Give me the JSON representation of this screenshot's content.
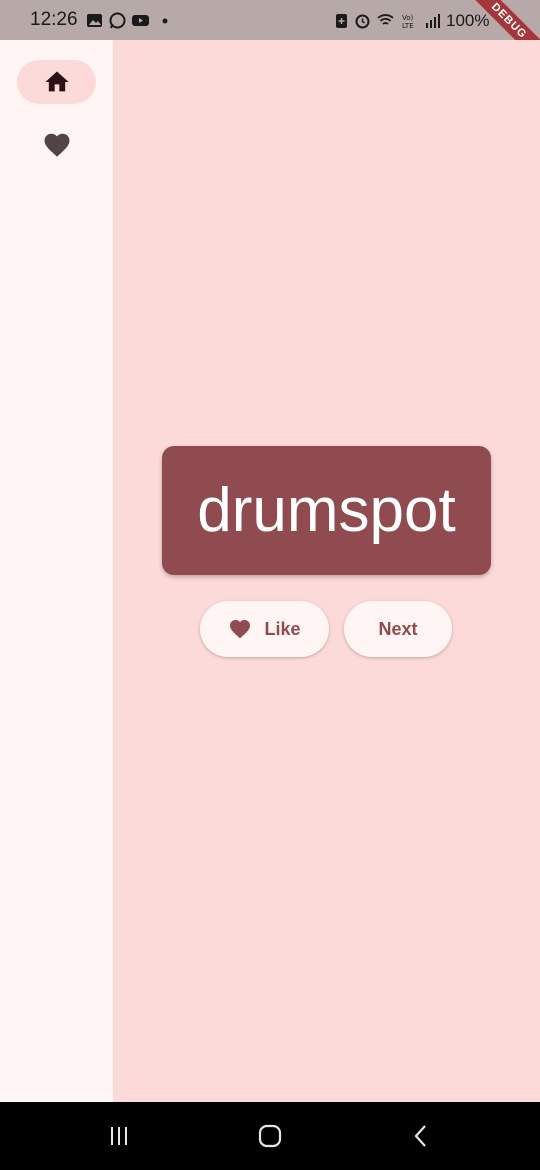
{
  "status_bar": {
    "time": "12:26",
    "battery": "100%",
    "left_icons": [
      "gallery-icon",
      "whatsapp-icon",
      "youtube-icon",
      "dot-icon"
    ],
    "right_icons": [
      "battery-saver-icon",
      "alarm-icon",
      "wifi-icon",
      "volte-icon",
      "signal-icon",
      "battery-icon"
    ],
    "debug_banner": "DEBUG"
  },
  "nav_rail": {
    "items": [
      {
        "icon": "home-icon",
        "selected": true
      },
      {
        "icon": "heart-icon",
        "selected": false
      }
    ]
  },
  "main": {
    "word": "drumspot",
    "like_label": "Like",
    "next_label": "Next"
  },
  "colors": {
    "primary": "#8f4b50",
    "background": "#fddada",
    "rail_background": "#fff5f4",
    "button_background": "#fff5f4"
  },
  "android_nav": {
    "buttons": [
      "recents-icon",
      "home-circle-icon",
      "back-icon"
    ]
  }
}
